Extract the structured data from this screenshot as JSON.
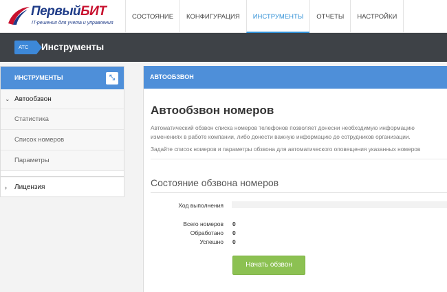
{
  "logo": {
    "name_part1": "Первый",
    "name_part2": "БИТ",
    "subtitle": "IT-решения для учета и управления"
  },
  "topnav": [
    {
      "label": "СОСТОЯНИЕ"
    },
    {
      "label": "КОНФИГУРАЦИЯ"
    },
    {
      "label": "ИНСТРУМЕНТЫ",
      "active": true
    },
    {
      "label": "ОТЧЕТЫ"
    },
    {
      "label": "НАСТРОЙКИ"
    }
  ],
  "titlebar": {
    "badge": "АТС",
    "title": "Инструменты"
  },
  "sidebar": {
    "header": "ИНСТРУМЕНТЫ",
    "collapse_icon": "collapse-icon",
    "parent": "Автообзвон",
    "children": [
      "Статистика",
      "Список номеров",
      "Параметры"
    ],
    "license": "Лицензия"
  },
  "panel": {
    "header": "АВТООБЗВОН",
    "title": "Автообзвон номеров",
    "desc_line1": "Автоматический обзвон списка номеров телефонов позволяет донесни необходимую информацию",
    "desc_line2": "изменениях в работе компании, либо донести важную информацию до сотрудников организации.",
    "desc_line3": "Задайте список номеров и параметры обзвона для автоматического оповещения указанных номеров",
    "section_title": "Состояние обзвона номеров",
    "progress_label": "Ход выполнения",
    "progress_value": 0,
    "stats": [
      {
        "label": "Всего номеров",
        "value": "0"
      },
      {
        "label": "Обработано",
        "value": "0"
      },
      {
        "label": "Успешно",
        "value": "0"
      }
    ],
    "start_button": "Начать обзвон"
  },
  "colors": {
    "accent_blue": "#4e8fd9",
    "active_tab": "#2e8fd6",
    "titlebar_bg": "#3e4247",
    "button_green": "#8cc152"
  }
}
